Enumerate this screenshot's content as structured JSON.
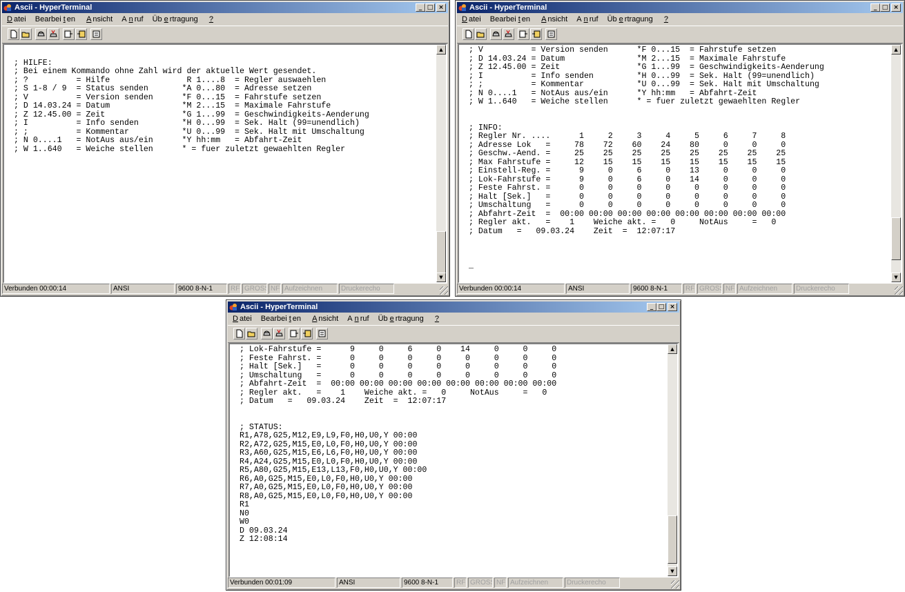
{
  "window": {
    "title": "Ascii - HyperTerminal",
    "menu": [
      {
        "pre": "",
        "u": "D",
        "post": "atei"
      },
      {
        "pre": "Bearbei",
        "u": "t",
        "post": "en"
      },
      {
        "pre": "",
        "u": "A",
        "post": "nsicht"
      },
      {
        "pre": "A",
        "u": "n",
        "post": "ruf"
      },
      {
        "pre": "Üb",
        "u": "e",
        "post": "rtragung"
      },
      {
        "pre": "",
        "u": "?",
        "post": ""
      }
    ],
    "toolbar_icons": [
      "new-icon",
      "open-icon",
      "connect-icon",
      "disconnect-icon",
      "send-icon",
      "receive-icon",
      "properties-icon"
    ],
    "controls": {
      "minimize": "_",
      "maximize": "□",
      "close": "×"
    }
  },
  "windows": [
    {
      "id": "help",
      "status": {
        "connected": "Verbunden 00:00:14",
        "emulation": "ANSI",
        "port": "9600 8-N-1",
        "rf": "RF",
        "gross": "GROSS",
        "nf": "NF",
        "record": "Aufzeichnen",
        "print": "Druckerecho"
      },
      "lines": [
        "",
        "; HILFE:",
        "; Bei einem Kommando ohne Zahl wird der aktuelle Wert gesendet.",
        "; ?          = Hilfe                R 1....8  = Regler auswaehlen",
        "; S 1-8 / 9  = Status senden       *A 0...80  = Adresse setzen",
        "; V          = Version senden      *F 0...15  = Fahrstufe setzen",
        "; D 14.03.24 = Datum               *M 2...15  = Maximale Fahrstufe",
        "; Z 12.45.00 = Zeit                *G 1...99  = Geschwindigkeits-Aenderung",
        "; I          = Info senden         *H 0...99  = Sek. Halt (99=unendlich)",
        "; ;          = Kommentar           *U 0...99  = Sek. Halt mit Umschaltung",
        "; N 0....1   = NotAus aus/ein      *Y hh:mm   = Abfahrt-Zeit",
        "; W 1..640   = Weiche stellen      * = fuer zuletzt gewaehlten Regler"
      ]
    },
    {
      "id": "info",
      "status": {
        "connected": "Verbunden 00:00:14",
        "emulation": "ANSI",
        "port": "9600 8-N-1",
        "rf": "RF",
        "gross": "GROSS",
        "nf": "NF",
        "record": "Aufzeichnen",
        "print": "Druckerecho"
      },
      "lines": [
        "; V          = Version senden      *F 0...15  = Fahrstufe setzen",
        "; D 14.03.24 = Datum               *M 2...15  = Maximale Fahrstufe",
        "; Z 12.45.00 = Zeit                *G 1...99  = Geschwindigkeits-Aenderung",
        "; I          = Info senden         *H 0...99  = Sek. Halt (99=unendlich)",
        "; ;          = Kommentar           *U 0...99  = Sek. Halt mit Umschaltung",
        "; N 0....1   = NotAus aus/ein      *Y hh:mm   = Abfahrt-Zeit",
        "; W 1..640   = Weiche stellen      * = fuer zuletzt gewaehlten Regler",
        "",
        "",
        "; INFO:",
        "; Regler Nr. ....      1     2     3     4     5     6     7     8",
        "; Adresse Lok   =     78    72    60    24    80     0     0     0",
        "; Geschw.-Aend. =     25    25    25    25    25    25    25    25",
        "; Max Fahrstufe =     12    15    15    15    15    15    15    15",
        "; Einstell-Reg. =      9     0     6     0    13     0     0     0",
        "; Lok-Fahrstufe =      9     0     6     0    14     0     0     0",
        "; Feste Fahrst. =      0     0     0     0     0     0     0     0",
        "; Halt [Sek.]   =      0     0     0     0     0     0     0     0",
        "; Umschaltung   =      0     0     0     0     0     0     0     0",
        "; Abfahrt-Zeit  =  00:00 00:00 00:00 00:00 00:00 00:00 00:00 00:00",
        "; Regler akt.   =    1    Weiche akt. =   0     NotAus     =   0",
        "; Datum   =   09.03.24    Zeit  =  12:07:17",
        "",
        "",
        "",
        "_"
      ]
    },
    {
      "id": "status",
      "status": {
        "connected": "Verbunden 00:01:09",
        "emulation": "ANSI",
        "port": "9600 8-N-1",
        "rf": "RF",
        "gross": "GROSS",
        "nf": "NF",
        "record": "Aufzeichnen",
        "print": "Druckerecho"
      },
      "lines": [
        "; Lok-Fahrstufe =      9     0     6     0    14     0     0     0",
        "; Feste Fahrst. =      0     0     0     0     0     0     0     0",
        "; Halt [Sek.]   =      0     0     0     0     0     0     0     0",
        "; Umschaltung   =      0     0     0     0     0     0     0     0",
        "; Abfahrt-Zeit  =  00:00 00:00 00:00 00:00 00:00 00:00 00:00 00:00",
        "; Regler akt.   =    1    Weiche akt. =   0     NotAus     =   0",
        "; Datum   =   09.03.24    Zeit  =  12:07:17",
        "",
        "",
        "; STATUS:",
        "R1,A78,G25,M12,E9,L9,F0,H0,U0,Y 00:00",
        "R2,A72,G25,M15,E0,L0,F0,H0,U0,Y 00:00",
        "R3,A60,G25,M15,E6,L6,F0,H0,U0,Y 00:00",
        "R4,A24,G25,M15,E0,L0,F0,H0,U0,Y 00:00",
        "R5,A80,G25,M15,E13,L13,F0,H0,U0,Y 00:00",
        "R6,A0,G25,M15,E0,L0,F0,H0,U0,Y 00:00",
        "R7,A0,G25,M15,E0,L0,F0,H0,U0,Y 00:00",
        "R8,A0,G25,M15,E0,L0,F0,H0,U0,Y 00:00",
        "R1",
        "N0",
        "W0",
        "D 09.03.24",
        "Z 12:08:14"
      ]
    }
  ]
}
